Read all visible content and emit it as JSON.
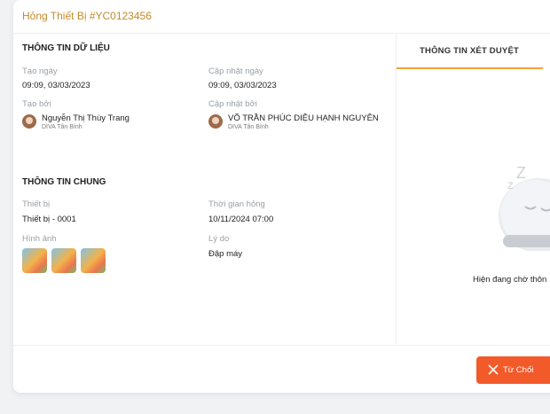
{
  "header": {
    "title": "Hỏng Thiết Bị #YC0123456"
  },
  "data_info": {
    "section_title": "THÔNG TIN DỮ LIỆU",
    "created_date_label": "Tạo ngày",
    "created_date": "09:09, 03/03/2023",
    "updated_date_label": "Cập nhật ngày",
    "updated_date": "09:09, 03/03/2023",
    "created_by_label": "Tạo bởi",
    "created_by_name": "Nguyễn Thị Thùy Trang",
    "created_by_branch": "DIVA Tân Bình",
    "updated_by_label": "Cập nhật bởi",
    "updated_by_name": "VÕ TRẦN PHÚC DIỆU HẠNH NGUYÊN",
    "updated_by_branch": "DIVA Tân Bình"
  },
  "general_info": {
    "section_title": "THÔNG TIN CHUNG",
    "device_label": "Thiết bị",
    "device": "Thiết bị - 0001",
    "broken_time_label": "Thời gian hỏng",
    "broken_time": "10/11/2024 07:00",
    "images_label": "Hình ảnh",
    "reason_label": "Lý do",
    "reason": "Đập máy"
  },
  "review": {
    "tab_label": "THÔNG TIN XÉT DUYỆT",
    "waiting_text": "Hiện đang chờ thôn"
  },
  "footer": {
    "reject_label": "Từ Chối"
  },
  "colors": {
    "accent": "#f0a33a",
    "title": "#c48a2c",
    "reject": "#f25a2a"
  }
}
